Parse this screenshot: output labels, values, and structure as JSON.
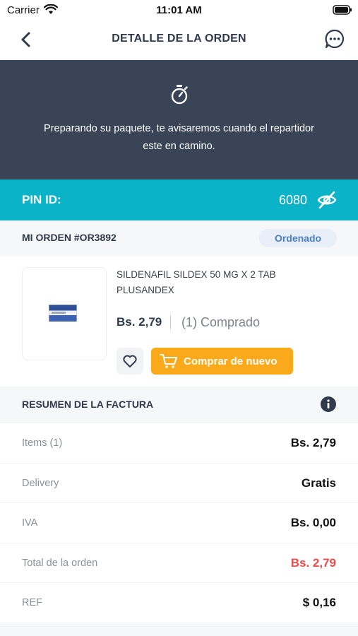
{
  "status_bar": {
    "carrier": "Carrier",
    "time": "11:01 AM"
  },
  "nav": {
    "title": "DETALLE DE LA ORDEN"
  },
  "banner": {
    "message": "Preparando su paquete, te avisaremos cuando el repartidor este en camino."
  },
  "pin": {
    "label": "PIN ID:",
    "value": "6080"
  },
  "order": {
    "label": "MI ORDEN #OR3892",
    "status": "Ordenado"
  },
  "product": {
    "name": "SILDENAFIL SILDEX 50 MG X 2 TAB PLUSANDEX",
    "price": "Bs. 2,79",
    "quantity": "(1) Comprado",
    "buy_again_label": "Comprar de nuevo"
  },
  "summary": {
    "title": "RESUMEN DE LA FACTURA",
    "rows": [
      {
        "label": "Items (1)",
        "value": "Bs. 2,79"
      },
      {
        "label": "Delivery",
        "value": "Gratis"
      },
      {
        "label": "IVA",
        "value": "Bs. 0,00"
      },
      {
        "label": "Total de la orden",
        "value": "Bs. 2,79"
      },
      {
        "label": "REF",
        "value": "$ 0,16"
      }
    ]
  },
  "colors": {
    "banner": "#394456",
    "pin_bar": "#0bb3c8",
    "accent_orange": "#f9a91a",
    "total_red": "#ef4b4b",
    "badge_text": "#4a7fc4"
  },
  "icons": [
    "back-chevron-icon",
    "chat-bubble-icon",
    "timer-icon",
    "eye-off-icon",
    "heart-icon",
    "cart-icon",
    "info-icon",
    "wifi-icon",
    "battery-icon"
  ]
}
